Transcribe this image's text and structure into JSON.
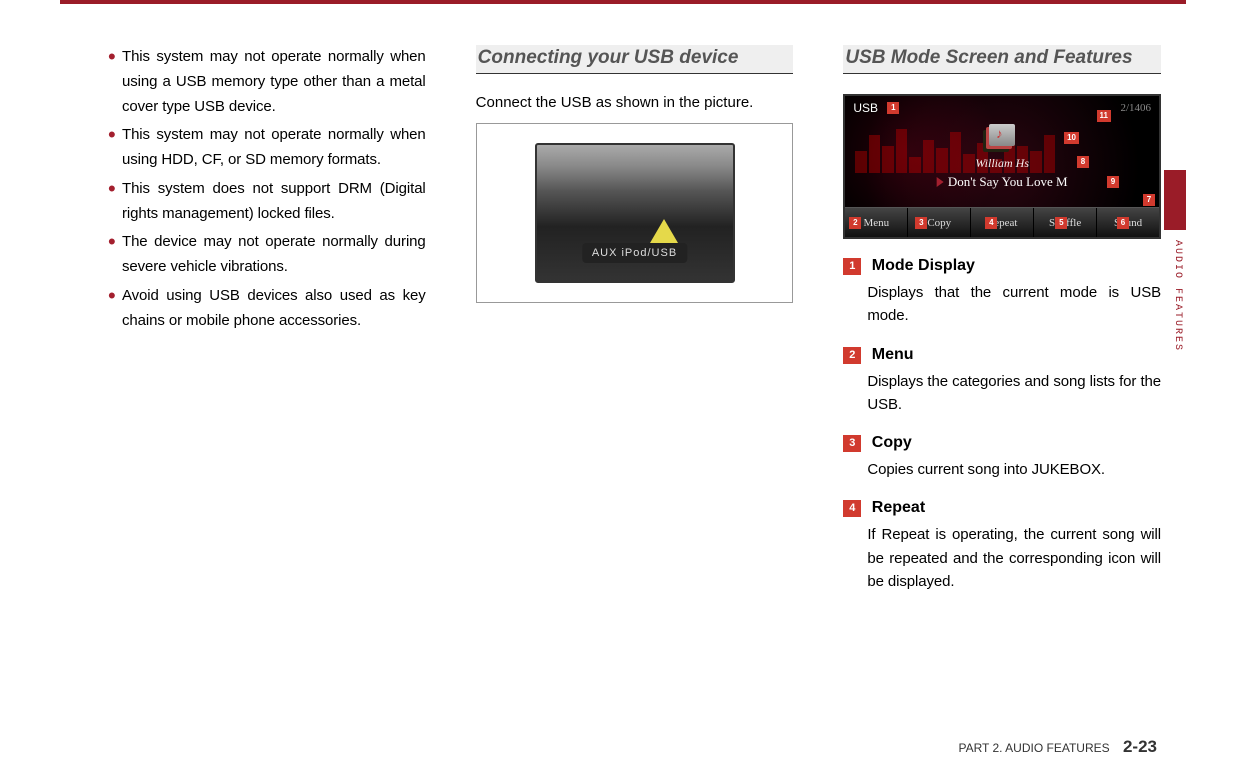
{
  "side_label": "AUDIO FEATURES",
  "column1": {
    "bullets": [
      "This system may not operate normally when using a USB memory type other than a metal cover type USB device.",
      "This system may not operate normally when using HDD, CF, or SD memory formats.",
      "This system does not support DRM (Digital rights management) locked files.",
      "The device may not operate normally during severe vehicle vibrations.",
      "Avoid using USB devices also used as key chains or mobile phone accessories."
    ]
  },
  "column2": {
    "heading": "Connecting your USB device",
    "caption": "Connect the USB as shown in the picture.",
    "panel_label": "AUX   iPod/USB"
  },
  "column3": {
    "heading": "USB Mode Screen and Features",
    "screen": {
      "mode_label": "USB",
      "track_counter": "2/1406",
      "artist": "William Hs",
      "song_title": "Don't Say You Love M",
      "bottom_buttons": [
        "Menu",
        "Copy",
        "Repeat",
        "Shuffle",
        "Sound"
      ]
    },
    "callouts": [
      "1",
      "2",
      "3",
      "4",
      "5",
      "6",
      "7",
      "8",
      "9",
      "10",
      "11"
    ],
    "features": [
      {
        "num": "1",
        "label": "Mode Display",
        "desc": "Displays that the current mode is USB mode."
      },
      {
        "num": "2",
        "label": "Menu",
        "desc": "Displays the categories and song lists for the USB."
      },
      {
        "num": "3",
        "label": "Copy",
        "desc": "Copies current song into JUKEBOX."
      },
      {
        "num": "4",
        "label": "Repeat",
        "desc": "If Repeat is operating, the current song will be repeated and the corresponding icon will be displayed."
      }
    ]
  },
  "footer": {
    "part": "PART 2. AUDIO FEATURES",
    "page": "2-23"
  }
}
